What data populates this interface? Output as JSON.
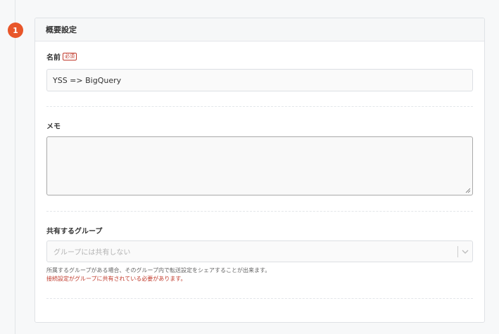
{
  "step": {
    "number": "1",
    "color": "#e8562a"
  },
  "panel": {
    "title": "概要設定"
  },
  "name_field": {
    "label": "名前",
    "required_badge": "必須",
    "value": "YSS => BigQuery"
  },
  "memo_field": {
    "label": "メモ",
    "value": ""
  },
  "group_field": {
    "label": "共有するグループ",
    "placeholder": "グループには共有しない",
    "help_text": "所属するグループがある場合、そのグループ内で転送設定をシェアすることが出来ます。",
    "warning_text": "接続設定がグループに共有されている必要があります。",
    "icons": {
      "dropdown": "chevron-down-icon"
    }
  }
}
